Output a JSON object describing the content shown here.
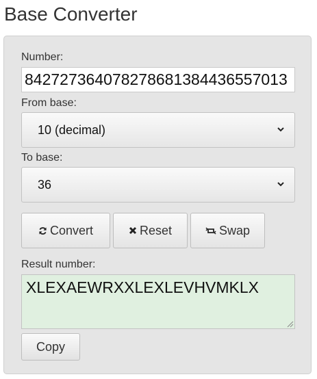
{
  "page": {
    "title": "Base Converter"
  },
  "form": {
    "number_label": "Number:",
    "number_value": "842727364078278681384436557013",
    "from_label": "From base:",
    "from_value": "10 (decimal)",
    "to_label": "To base:",
    "to_value": "36",
    "result_label": "Result number:",
    "result_value": "XLEXAEWRXXLEXLEVHVMKLX"
  },
  "buttons": {
    "convert": "Convert",
    "reset": "Reset",
    "swap": "Swap",
    "copy": "Copy"
  },
  "icons": {
    "convert": "refresh-icon",
    "reset": "x-icon",
    "swap": "swap-icon",
    "select": "chevron-down-icon"
  },
  "colors": {
    "panel_bg": "#e5e5e5",
    "result_bg": "#e0f0e0"
  }
}
